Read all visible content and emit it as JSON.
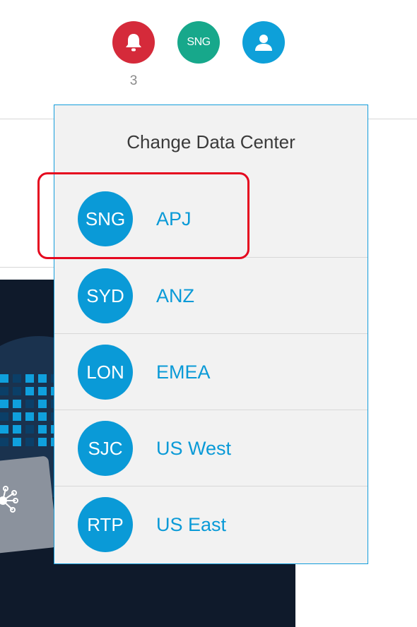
{
  "header": {
    "notification_count": "3",
    "datacenter_badge": "SNG",
    "icons": {
      "notifications": "bell-icon",
      "profile": "user-icon"
    },
    "colors": {
      "bell": "#d52a3a",
      "datacenter": "#17a88b",
      "profile": "#0ea0d9"
    }
  },
  "dropdown": {
    "title": "Change Data Center",
    "accent": "#0a9ad7",
    "items": [
      {
        "code": "SNG",
        "region": "APJ",
        "highlighted": true
      },
      {
        "code": "SYD",
        "region": "ANZ"
      },
      {
        "code": "LON",
        "region": "EMEA"
      },
      {
        "code": "SJC",
        "region": "US West"
      },
      {
        "code": "RTP",
        "region": "US East"
      }
    ]
  }
}
